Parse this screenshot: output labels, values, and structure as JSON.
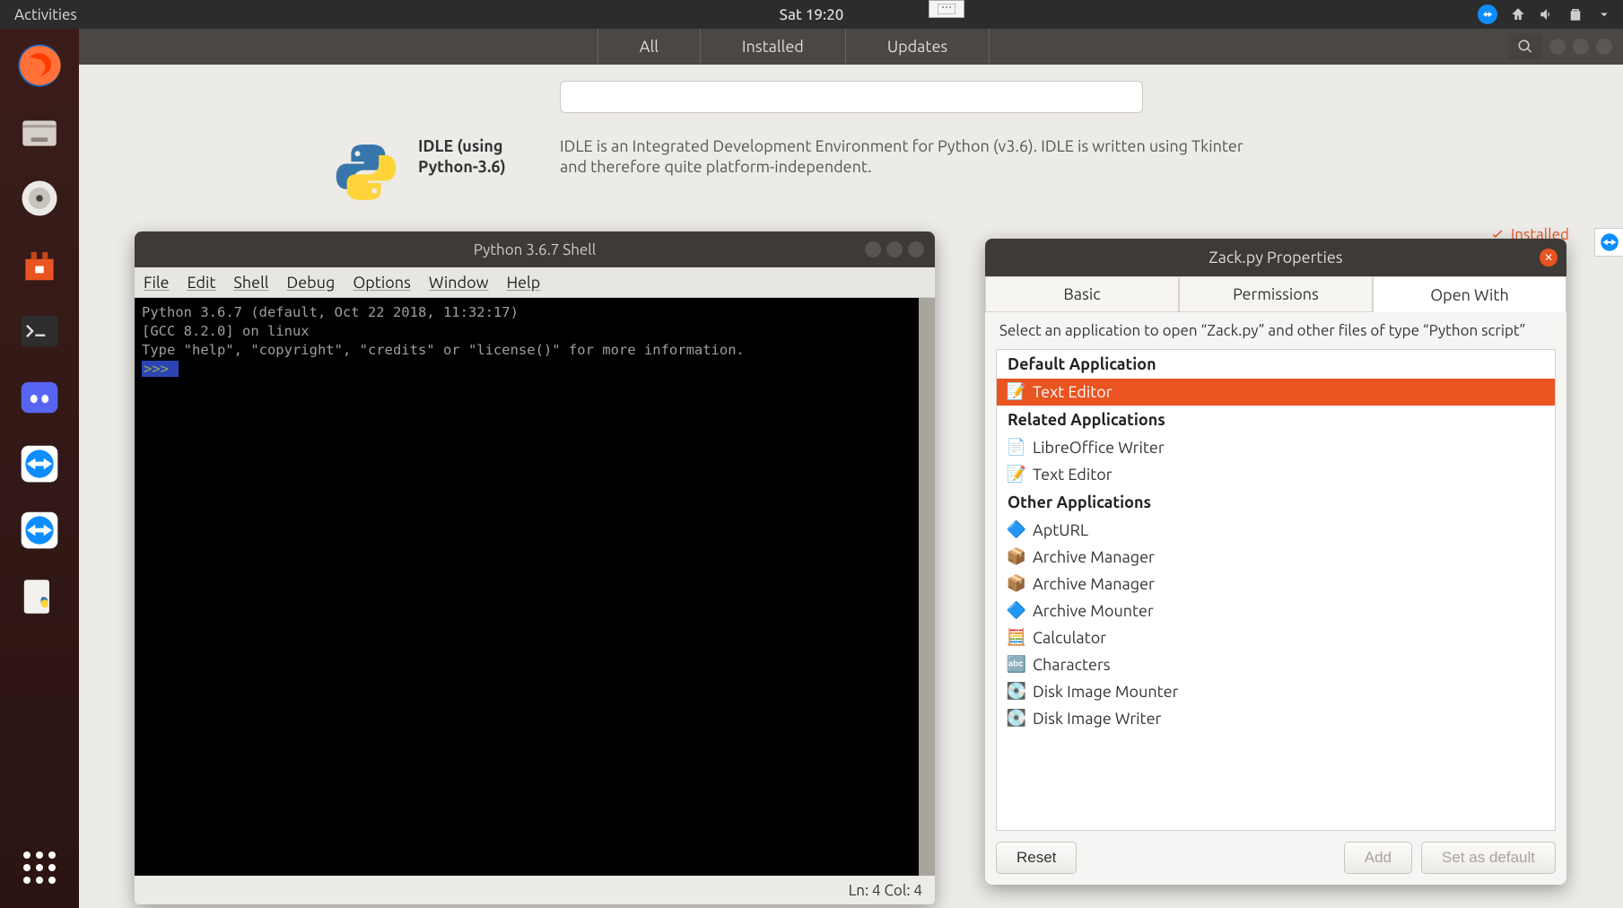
{
  "topbar": {
    "activities": "Activities",
    "datetime": "Sat  19:20"
  },
  "software": {
    "tabs": {
      "all": "All",
      "installed": "Installed",
      "updates": "Updates"
    },
    "search_placeholder": "",
    "result": {
      "name": "IDLE (using Python-3.6)",
      "description": "IDLE is an Integrated Development Environment for Python (v3.6). IDLE is written using Tkinter and therefore quite platform-independent.",
      "badge": "Installed"
    }
  },
  "idle": {
    "title": "Python 3.6.7 Shell",
    "menu": {
      "file": "File",
      "edit": "Edit",
      "shell": "Shell",
      "debug": "Debug",
      "options": "Options",
      "window": "Window",
      "help": "Help"
    },
    "line1": "Python 3.6.7 (default, Oct 22 2018, 11:32:17)",
    "line2": "[GCC 8.2.0] on linux",
    "line3": "Type \"help\", \"copyright\", \"credits\" or \"license()\" for more information.",
    "prompt": ">>> ",
    "status": "Ln: 4  Col: 4"
  },
  "props": {
    "title": "Zack.py Properties",
    "tabs": {
      "basic": "Basic",
      "permissions": "Permissions",
      "openwith": "Open With"
    },
    "desc": "Select an application to open “Zack.py” and other files of type “Python script”",
    "headings": {
      "default": "Default Application",
      "related": "Related Applications",
      "other": "Other Applications"
    },
    "default_app": "Text Editor",
    "related": [
      "LibreOffice Writer",
      "Text Editor"
    ],
    "other": [
      "AptURL",
      "Archive Manager",
      "Archive Manager",
      "Archive Mounter",
      "Calculator",
      "Characters",
      "Disk Image Mounter",
      "Disk Image Writer"
    ],
    "buttons": {
      "reset": "Reset",
      "add": "Add",
      "setdefault": "Set as default"
    }
  }
}
